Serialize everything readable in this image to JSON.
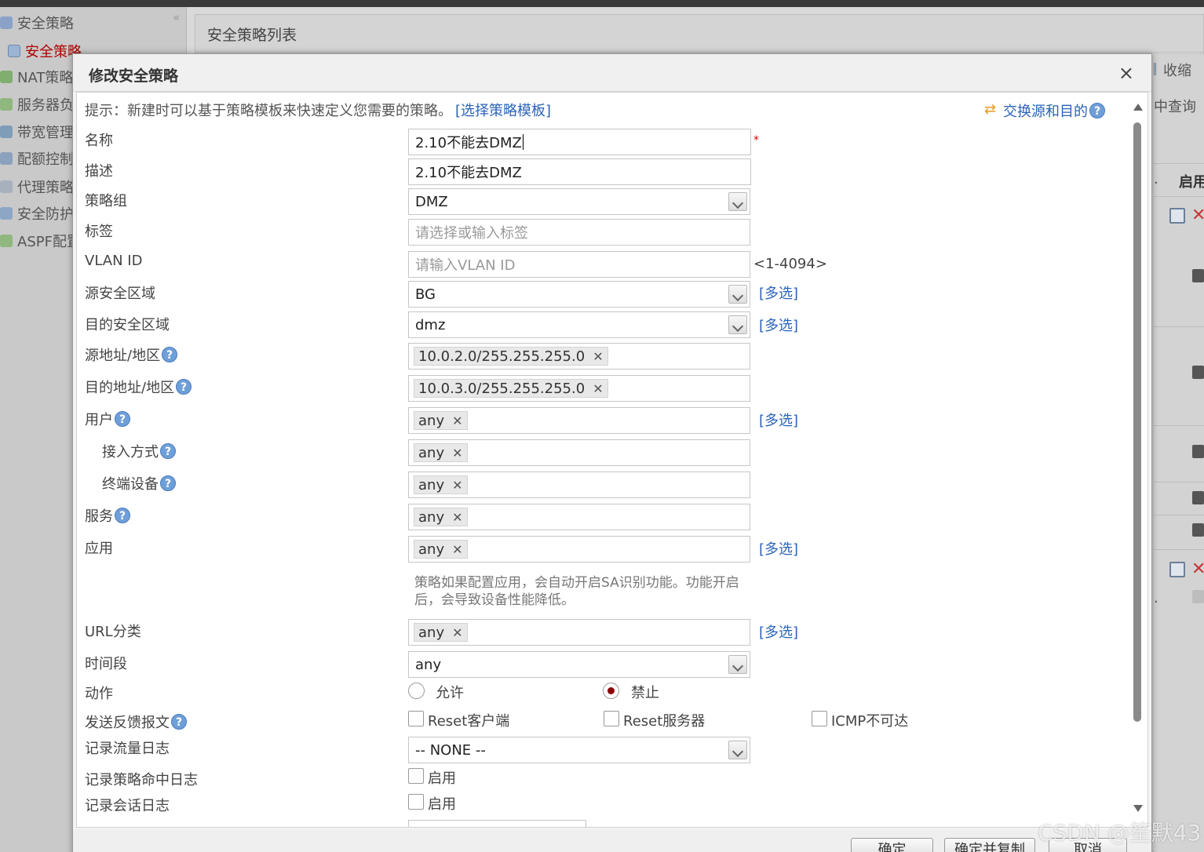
{
  "left_nav": {
    "items": [
      {
        "label": "安全策略",
        "icon": "shield-icon",
        "active": false
      },
      {
        "label": "安全策略",
        "icon": "policy-list-icon",
        "active": true
      },
      {
        "label": "NAT策略",
        "icon": "nat-icon",
        "active": false
      },
      {
        "label": "服务器负",
        "icon": "server-icon",
        "active": false
      },
      {
        "label": "带宽管理",
        "icon": "bandwidth-icon",
        "active": false
      },
      {
        "label": "配额控制",
        "icon": "quota-icon",
        "active": false
      },
      {
        "label": "代理策略",
        "icon": "proxy-icon",
        "active": false
      },
      {
        "label": "安全防护",
        "icon": "protection-icon",
        "active": false
      },
      {
        "label": "ASPF配置",
        "icon": "aspf-icon",
        "active": false
      }
    ],
    "collapse_glyph": "«"
  },
  "main": {
    "title": "安全策略列表",
    "right_fragments": {
      "collapse": "收缩",
      "query": "中查询",
      "enable_header": "启用",
      "dot1": ".",
      "dot2": "."
    }
  },
  "dialog": {
    "title": "修改安全策略",
    "close_glyph": "×",
    "hint": "提示：新建时可以基于策略模板来快速定义您需要的策略。",
    "template_link": "[选择策略模板]",
    "swap_link": "交换源和目的",
    "help_glyph": "?",
    "remove_glyph": "✕",
    "fields": {
      "name": {
        "label": "名称",
        "value": "2.10不能去DMZ",
        "required_mark": "*"
      },
      "description": {
        "label": "描述",
        "value": "2.10不能去DMZ"
      },
      "policy_group": {
        "label": "策略组",
        "value": "DMZ"
      },
      "tag": {
        "label": "标签",
        "placeholder": "请选择或输入标签"
      },
      "vlan_id": {
        "label": "VLAN ID",
        "placeholder": "请输入VLAN ID",
        "range": "<1-4094>"
      },
      "src_zone": {
        "label": "源安全区域",
        "value": "BG",
        "multi": "[多选]"
      },
      "dst_zone": {
        "label": "目的安全区域",
        "value": "dmz",
        "multi": "[多选]"
      },
      "src_addr": {
        "label": "源地址/地区",
        "chip": "10.0.2.0/255.255.255.0"
      },
      "dst_addr": {
        "label": "目的地址/地区",
        "chip": "10.0.3.0/255.255.255.0"
      },
      "user": {
        "label": "用户",
        "chip": "any",
        "multi": "[多选]"
      },
      "access_mode": {
        "label": "接入方式",
        "chip": "any"
      },
      "terminal": {
        "label": "终端设备",
        "chip": "any"
      },
      "service": {
        "label": "服务",
        "chip": "any"
      },
      "application": {
        "label": "应用",
        "chip": "any",
        "multi": "[多选]",
        "note_line1": "策略如果配置应用，会自动开启SA识别功能。功能开启",
        "note_line2": "后，会导致设备性能降低。"
      },
      "url_category": {
        "label": "URL分类",
        "chip": "any",
        "multi": "[多选]"
      },
      "time_range": {
        "label": "时间段",
        "value": "any"
      },
      "action": {
        "label": "动作",
        "permit": "允许",
        "deny": "禁止",
        "selected": "禁止"
      },
      "feedback": {
        "label": "发送反馈报文",
        "reset_client": "Reset客户端",
        "reset_server": "Reset服务器",
        "icmp_unreachable": "ICMP不可达"
      },
      "traffic_log": {
        "label": "记录流量日志",
        "value": "-- NONE --"
      },
      "policy_hit_log": {
        "label": "记录策略命中日志",
        "enable": "启用"
      },
      "session_log": {
        "label": "记录会话日志",
        "enable": "启用"
      }
    },
    "buttons": {
      "ok": "确定",
      "ok_copy": "确定并复制",
      "cancel": "取消"
    }
  },
  "watermark": "CSDN @笙默43",
  "colors": {
    "link": "#2b63b8",
    "active_nav": "#b10000",
    "radio_selected": "#8b0000",
    "help": "#6f9fd8"
  }
}
